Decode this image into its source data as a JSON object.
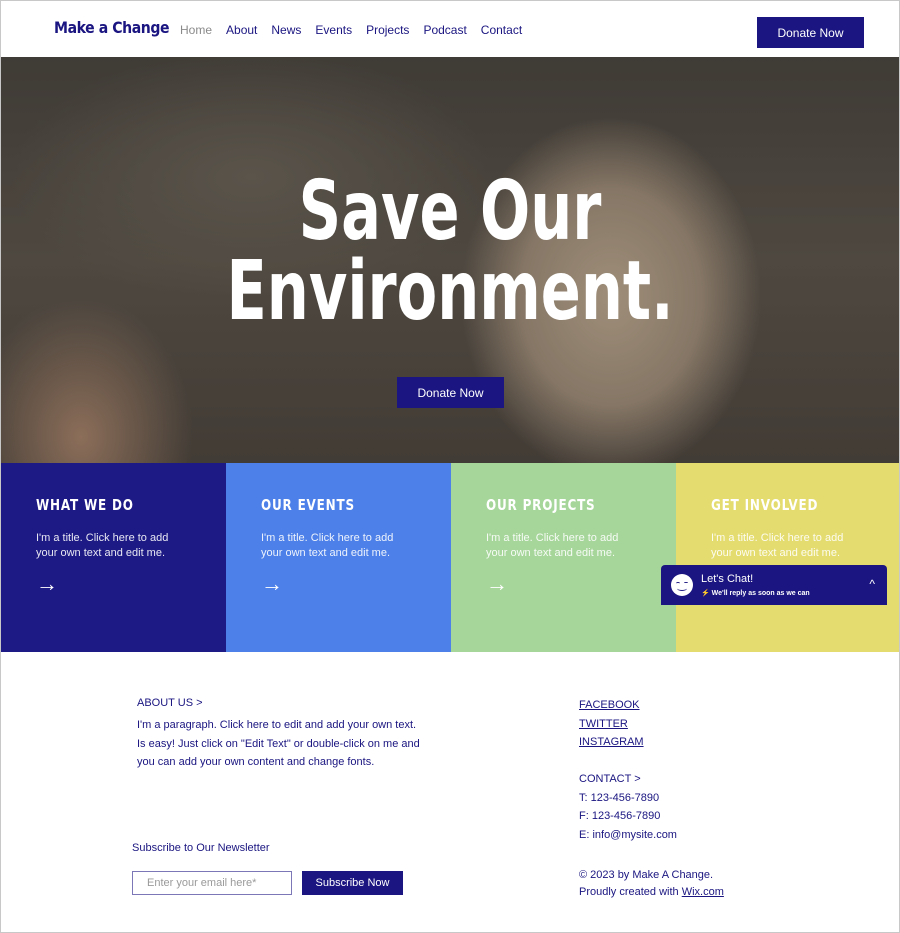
{
  "header": {
    "logo": "Make a Change",
    "nav": [
      {
        "label": "Home",
        "active": true
      },
      {
        "label": "About"
      },
      {
        "label": "News"
      },
      {
        "label": "Events"
      },
      {
        "label": "Projects"
      },
      {
        "label": "Podcast"
      },
      {
        "label": "Contact"
      }
    ],
    "donate_label": "Donate Now"
  },
  "hero": {
    "title_line1": "Save Our",
    "title_line2": "Environment.",
    "donate_label": "Donate Now"
  },
  "cards": [
    {
      "title": "WHAT WE DO",
      "text": "I'm a title. Click here to add your own text and edit me.",
      "arrow": "→",
      "color": "#1d1a85"
    },
    {
      "title": "OUR EVENTS",
      "text": "I'm a title. Click here to add your own text and edit me.",
      "arrow": "→",
      "color": "#4d80e8"
    },
    {
      "title": "OUR PROJECTS",
      "text": "I'm a title. Click here to add your own text and edit me.",
      "arrow": "→",
      "color": "#a6d69a"
    },
    {
      "title": "GET INVOLVED",
      "text": "I'm a title. Click here to add your own text and edit me.",
      "arrow": "→",
      "color": "#e4dc6e"
    }
  ],
  "chat": {
    "title": "Let's Chat!",
    "subtitle": "⚡ We'll reply as soon as we can",
    "icon": "smiley-face-icon",
    "caret": "^"
  },
  "footer": {
    "about_heading": "ABOUT US >",
    "about_paragraph": "I'm a paragraph. Click here to edit and add your own text. Is easy! Just click on \"Edit Text\" or double-click on me and you can add your own content and change fonts.",
    "newsletter_label": "Subscribe to Our Newsletter",
    "email_placeholder": "Enter your email here*",
    "subscribe_label": "Subscribe Now",
    "social": [
      "FACEBOOK",
      "TWITTER",
      "INSTAGRAM"
    ],
    "contact_heading": "CONTACT >",
    "phone": "T: 123-456-7890",
    "fax": "F: 123-456-7890",
    "email": "E: info@mysite.com",
    "copyright": "© 2023 by Make A Change.",
    "created_prefix": "Proudly created with ",
    "created_link": "Wix.com"
  },
  "colors": {
    "brand": "#1a1580",
    "nav_active": "#8a8a8a"
  }
}
